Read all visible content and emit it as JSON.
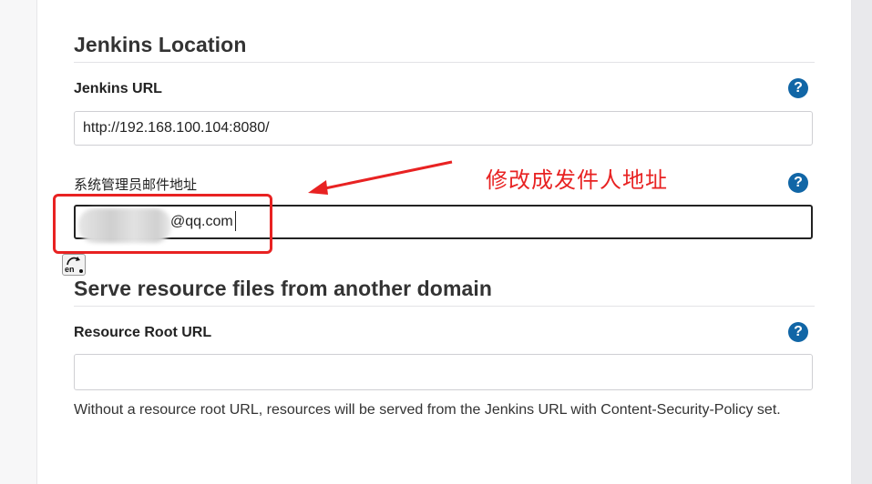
{
  "sections": {
    "location": {
      "title": "Jenkins Location"
    },
    "resource": {
      "title": "Serve resource files from another domain"
    }
  },
  "fields": {
    "jenkins_url": {
      "label": "Jenkins URL",
      "value": "http://192.168.100.104:8080/"
    },
    "admin_email": {
      "label": "系统管理员邮件地址",
      "value": "@qq.com"
    },
    "resource_root_url": {
      "label": "Resource Root URL",
      "value": "",
      "description": "Without a resource root URL, resources will be served from the Jenkins URL with Content-Security-Policy set."
    }
  },
  "help_glyph": "?",
  "annotation": {
    "text": "修改成发件人地址",
    "color": "#e82222"
  },
  "ime_indicator": {
    "label": "en"
  },
  "colors": {
    "help": "#1166a6",
    "annotation": "#e82222"
  }
}
